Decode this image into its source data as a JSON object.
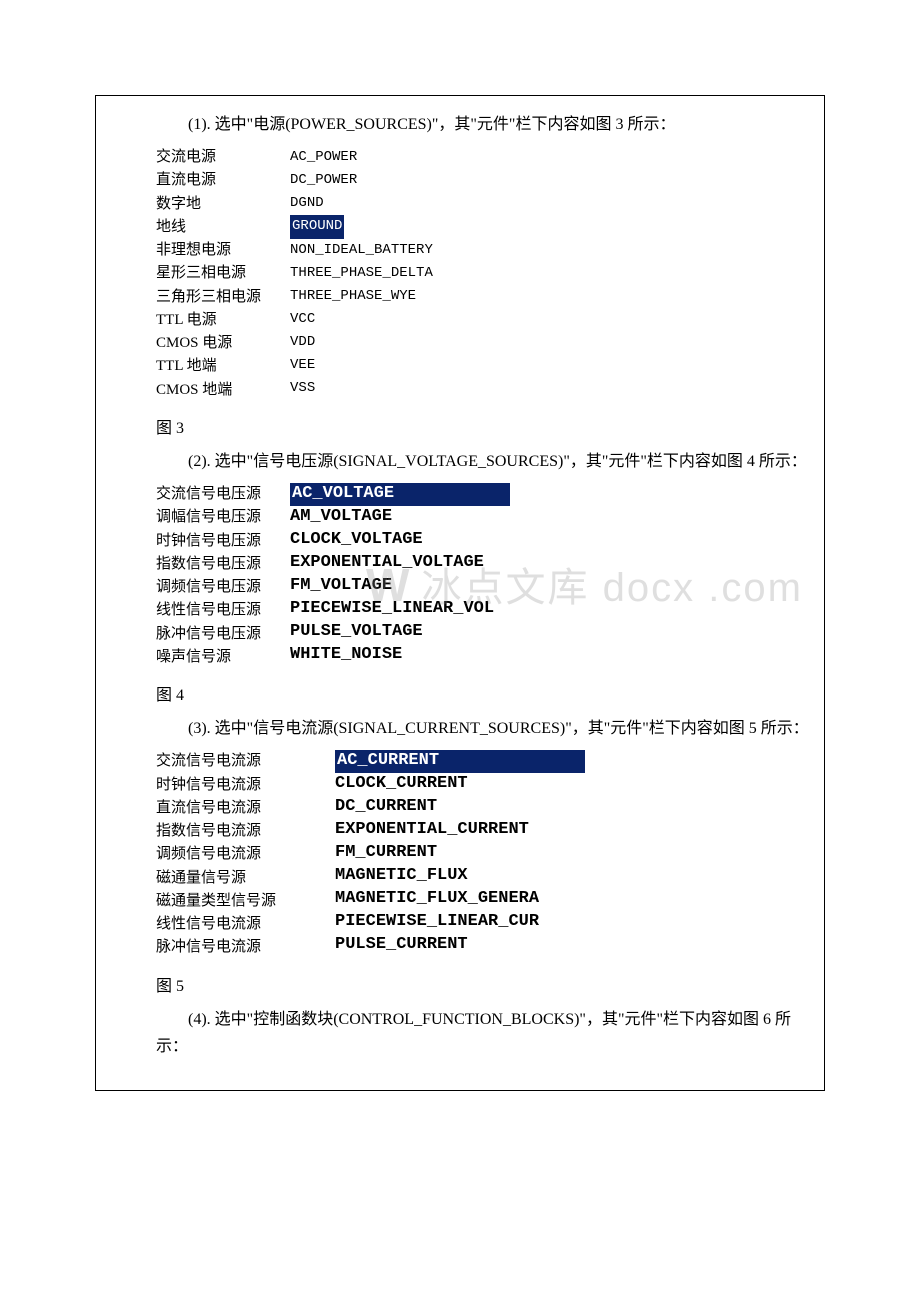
{
  "sections": {
    "s1": {
      "intro": "(1). 选中\"电源(POWER_SOURCES)\"，其\"元件\"栏下内容如图 3 所示：",
      "left": [
        "交流电源",
        "直流电源",
        "数字地",
        "地线",
        "非理想电源",
        "星形三相电源",
        "三角形三相电源",
        "TTL 电源",
        "CMOS 电源",
        "TTL 地端",
        "CMOS 地端"
      ],
      "right": [
        "AC_POWER",
        "DC_POWER",
        "DGND",
        "GROUND",
        "NON_IDEAL_BATTERY",
        "THREE_PHASE_DELTA",
        "THREE_PHASE_WYE",
        "VCC",
        "VDD",
        "VEE",
        "VSS"
      ],
      "highlight_index": 3,
      "caption": "图 3"
    },
    "s2": {
      "intro": "(2). 选中\"信号电压源(SIGNAL_VOLTAGE_SOURCES)\"，其\"元件\"栏下内容如图 4 所示：",
      "left": [
        "交流信号电压源",
        "调幅信号电压源",
        "时钟信号电压源",
        "指数信号电压源",
        "调频信号电压源",
        "线性信号电压源",
        "脉冲信号电压源",
        "噪声信号源"
      ],
      "right": [
        "AC_VOLTAGE",
        "AM_VOLTAGE",
        "CLOCK_VOLTAGE",
        "EXPONENTIAL_VOLTAGE",
        "FM_VOLTAGE",
        "PIECEWISE_LINEAR_VOL",
        "PULSE_VOLTAGE",
        "WHITE_NOISE"
      ],
      "highlight_index": 0,
      "caption": "图 4"
    },
    "s3": {
      "intro": "(3). 选中\"信号电流源(SIGNAL_CURRENT_SOURCES)\"，其\"元件\"栏下内容如图 5 所示：",
      "left": [
        "交流信号电流源",
        "时钟信号电流源",
        "直流信号电流源",
        "指数信号电流源",
        "调频信号电流源",
        "磁通量信号源",
        "磁通量类型信号源",
        "线性信号电流源",
        "脉冲信号电流源"
      ],
      "right": [
        "AC_CURRENT",
        "CLOCK_CURRENT",
        "DC_CURRENT",
        "EXPONENTIAL_CURRENT",
        "FM_CURRENT",
        "MAGNETIC_FLUX",
        "MAGNETIC_FLUX_GENERA",
        "PIECEWISE_LINEAR_CUR",
        "PULSE_CURRENT"
      ],
      "highlight_index": 0,
      "caption": "图 5"
    },
    "s4": {
      "intro": "(4). 选中\"控制函数块(CONTROL_FUNCTION_BLOCKS)\"，其\"元件\"栏下内容如图 6 所示："
    }
  },
  "watermark": {
    "logo": "W",
    "text": "冰点文库 docx .com"
  }
}
